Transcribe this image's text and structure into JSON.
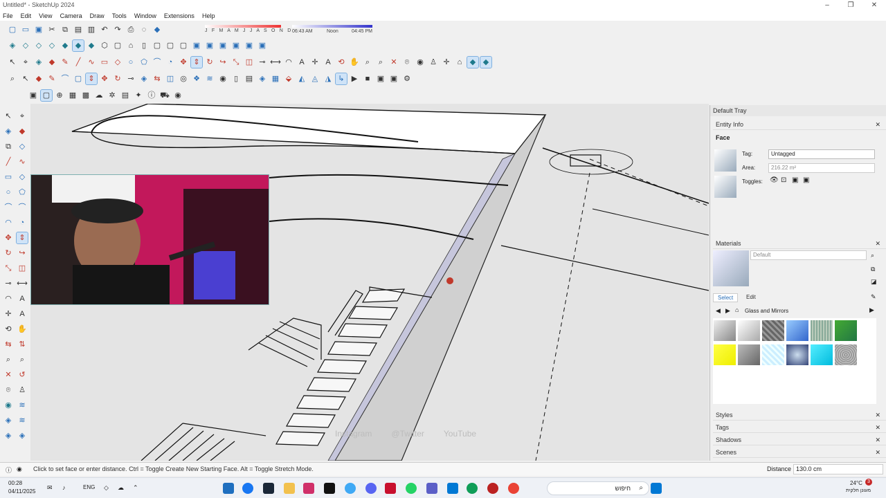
{
  "window": {
    "title": "Untitled* - SketchUp 2024",
    "controls": [
      "–",
      "❐",
      "✕"
    ]
  },
  "menu": [
    "File",
    "Edit",
    "View",
    "Camera",
    "Draw",
    "Tools",
    "Window",
    "Extensions",
    "Help"
  ],
  "shadow": {
    "months": "J F M A M J J A S O N D",
    "time_start": "06:43 AM",
    "time_mid": "Noon",
    "time_end": "04:45 PM"
  },
  "tray": {
    "title": "Default Tray",
    "entity_info": {
      "header": "Entity Info",
      "entity": "Face",
      "tag_label": "Tag:",
      "tag_value": "Untagged",
      "area_label": "Area:",
      "area_value": "216.22 m²",
      "toggles_label": "Toggles:"
    },
    "materials": {
      "header": "Materials",
      "name": "Default",
      "tab_select": "Select",
      "tab_edit": "Edit",
      "collection": "Glass and Mirrors"
    },
    "sections": [
      "Styles",
      "Tags",
      "Shadows",
      "Scenes"
    ]
  },
  "social": {
    "instagram": "Instagram",
    "twitter": "@Twitter",
    "youtube": "YouTube"
  },
  "status": {
    "hint": "Click to set face or enter distance.  Ctrl = Toggle Create New Starting Face.  Alt = Toggle Stretch Mode.",
    "measure_label": "Distance",
    "measure_value": "130.0 cm"
  },
  "taskbar": {
    "time": "00:28",
    "date": "04/11/2025",
    "lang": "ENG",
    "weather": "24°C",
    "weather_note": "מעונן חלקית",
    "search": "חיפוש",
    "badge": "3"
  },
  "colors": {
    "accent": "#2a6fb8",
    "selection": "#cfe3f7",
    "viewport": "#e4e4e4",
    "webcam_bg": "#c2185b"
  }
}
